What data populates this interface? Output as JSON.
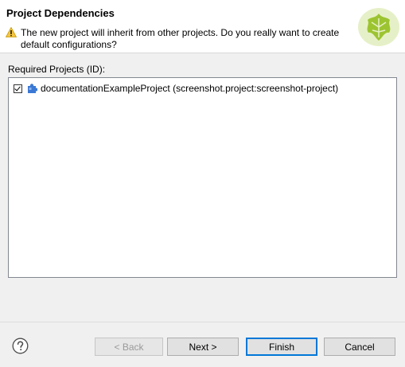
{
  "dialog": {
    "title": "Project Dependencies",
    "message_line1": "The new project will inherit from other projects. Do you really want to create",
    "message_line2": "default configurations?"
  },
  "list": {
    "label": "Required Projects (ID):",
    "items": [
      {
        "label": "documentationExampleProject (screenshot.project:screenshot-project)",
        "checked": true
      }
    ]
  },
  "buttons": {
    "back": "< Back",
    "next": "Next >",
    "finish": "Finish",
    "cancel": "Cancel"
  },
  "icons": {
    "warning": "warning-icon",
    "banner": "leaf-banner-icon",
    "project": "project-puzzle-icon",
    "help": "help-icon"
  }
}
